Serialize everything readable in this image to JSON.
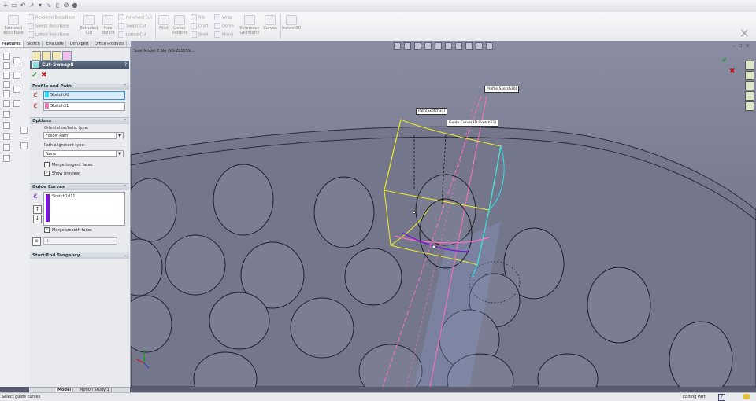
{
  "ribbon": {
    "extruded_boss": "Extruded\nBoss/Base",
    "revolved_boss": "Revolved Boss/Base",
    "swept_boss": "Swept Boss/Base",
    "lofted_boss": "Lofted Boss/Base",
    "extruded_cut": "Extruded\nCut",
    "hole_wizard": "Hole\nWizard",
    "revolved_cut": "Revolved Cut",
    "swept_cut": "Swept Cut",
    "lofted_cut": "Lofted Cut",
    "fillet": "Fillet",
    "linear_pattern": "Linear\nPattern",
    "rib": "Rib",
    "draft": "Draft",
    "shell": "Shell",
    "wrap": "Wrap",
    "dome": "Dome",
    "mirror": "Mirror",
    "reference_geometry": "Reference\nGeometry",
    "curves": "Curves",
    "instant3d": "Instant3D"
  },
  "tabs": [
    "Features",
    "Sketch",
    "Evaluate",
    "DimXpert",
    "Office Products"
  ],
  "property_manager": {
    "title": "Cut-Sweep8",
    "help": "?",
    "sections": {
      "profile_path": "Profile and Path",
      "options": "Options",
      "guide_curves": "Guide Curves",
      "start_end": "Start/End Tangency"
    },
    "profile_sketch": "Sketch30",
    "path_sketch": "Sketch31",
    "orientation_label": "Orientation/twist type:",
    "orientation_value": "Follow Path",
    "alignment_label": "Path alignment type:",
    "alignment_value": "None",
    "merge_tangent": "Merge tangent faces",
    "show_preview": "Show preview",
    "guide_curve_item": "Sketch1d11",
    "merge_smooth": "Merge smooth faces",
    "spin_value": "1"
  },
  "viewport": {
    "model_title": "Sole Model 7.Sle (VS-2L1059...",
    "callout_profile": "Profile(Sketch30)",
    "callout_path": "Path(Sketch31)",
    "callout_guide": "Guide Curve(3D Sketch11)"
  },
  "bottom_tabs": [
    "Model",
    "Motion Study 1"
  ],
  "status": {
    "left": "Select guide curves",
    "right": "Editing Part",
    "help": "?"
  },
  "colors": {
    "profile_swatch": "#2ee0e8",
    "path_swatch": "#f07ac0",
    "guide_bar": "#7a16d8",
    "sweep_preview": "#e6e62a",
    "path_line": "#ff6fc0"
  }
}
